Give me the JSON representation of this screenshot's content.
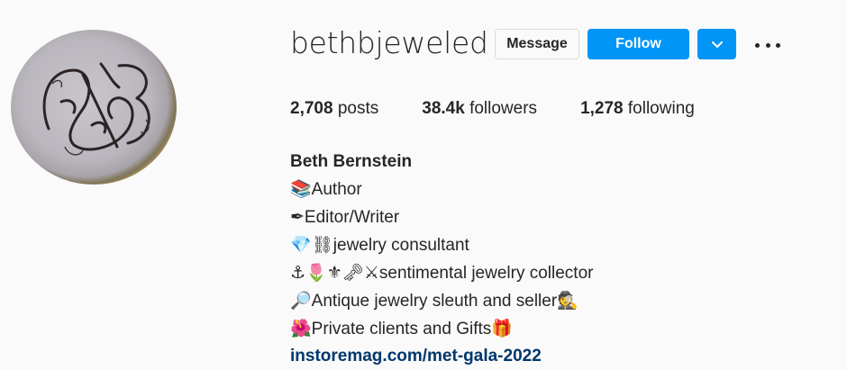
{
  "profile": {
    "username": "bethbjeweled",
    "avatar_icon": "monogram-seal-ring-avatar"
  },
  "actions": {
    "message_label": "Message",
    "follow_label": "Follow",
    "dropdown_icon": "chevron-down-icon",
    "more_icon": "more-options-icon"
  },
  "stats": {
    "posts_count": "2,708",
    "posts_label": "posts",
    "followers_count": "38.4k",
    "followers_label": "followers",
    "following_count": "1,278",
    "following_label": "following"
  },
  "bio": {
    "full_name": "Beth Bernstein",
    "lines": [
      {
        "emoji": "📚",
        "text": "Author"
      },
      {
        "emoji": "✒",
        "text": "Editor/Writer"
      },
      {
        "emoji": "💎⛓",
        "text": "jewelry consultant"
      },
      {
        "emoji": "⚓🌷⚜🗝⚔",
        "text": "sentimental jewelry collector"
      },
      {
        "emoji": "🔎",
        "text": "Antique jewelry sleuth and seller",
        "suffix": "🕵"
      },
      {
        "emoji": "🌺",
        "text": "Private clients and Gifts",
        "suffix": "🎁"
      }
    ],
    "link": "instoremag.com/met-gala-2022"
  },
  "colors": {
    "follow_blue": "#0095f6",
    "link_blue": "#00376b",
    "text": "#262626",
    "background": "#fafafa"
  }
}
